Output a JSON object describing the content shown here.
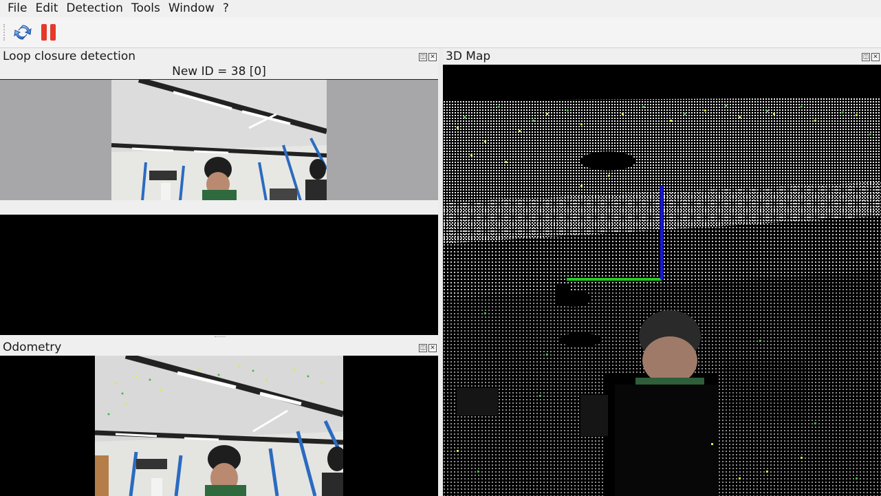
{
  "menu": [
    "File",
    "Edit",
    "Detection",
    "Tools",
    "Window",
    "?"
  ],
  "toolbar": {
    "buttons": [
      {
        "name": "refresh-button",
        "icon": "refresh-icon"
      },
      {
        "name": "pause-button",
        "icon": "pause-icon"
      }
    ]
  },
  "loop_closure": {
    "title": "Loop closure detection",
    "new_id_label": "New ID = 38 [0]"
  },
  "odometry": {
    "title": "Odometry"
  },
  "map3d": {
    "title": "3D Map"
  },
  "colors": {
    "axis_green": "#22cc22",
    "axis_blue": "#1818d8",
    "feature_yellow": "#e6e640",
    "feature_green": "#3fbf3f"
  }
}
